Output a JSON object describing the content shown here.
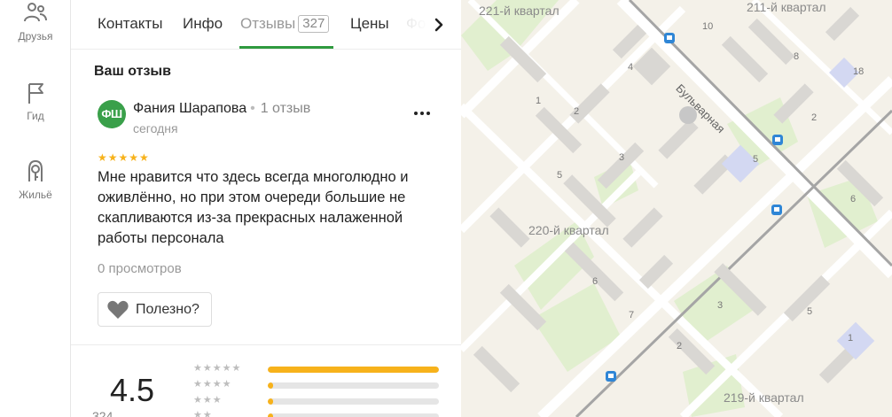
{
  "nav_rail": {
    "items": [
      {
        "label": "Друзья",
        "icon": "friends-icon"
      },
      {
        "label": "Гид",
        "icon": "flag-icon"
      },
      {
        "label": "Жильё",
        "icon": "house-key-icon"
      }
    ]
  },
  "tabs": {
    "items": [
      {
        "label": "Контакты"
      },
      {
        "label": "Инфо"
      },
      {
        "label": "Отзывы",
        "badge": "327",
        "active": true
      },
      {
        "label": "Цены"
      },
      {
        "label": "Фо"
      }
    ],
    "next_icon": "chevron-right-icon"
  },
  "review": {
    "section_title": "Ваш отзыв",
    "avatar_initials": "ФШ",
    "author": "Фания Шарапова",
    "author_review_count": "1 отзыв",
    "date": "сегодня",
    "stars": "★★★★★",
    "rating": 5,
    "text": "Мне нравится что здесь всегда многолюдно и оживлённо, но при этом очереди большие не скапливаются из-за прекрасных налаженной работы персонала",
    "views": "0 просмотров",
    "useful_label": "Полезно?"
  },
  "summary": {
    "rating_value": "4.5",
    "rating_count_partial": "324",
    "distribution": [
      {
        "stars": "★★★★★",
        "fraction": 1.0
      },
      {
        "stars": "★★★★",
        "fraction": 0.03
      },
      {
        "stars": "★★★",
        "fraction": 0.03
      },
      {
        "stars": "★★",
        "fraction": 0.03
      }
    ],
    "colors": {
      "bar_fill": "#f7b21b",
      "bar_track": "#e5e5e5"
    }
  },
  "map": {
    "labels": {
      "q221": "221-й квартал",
      "q211": "211-й квартал",
      "q220": "220-й квартал",
      "q219": "219-й квартал",
      "street": "Бульварная"
    },
    "building_numbers": {
      "n10": "10",
      "n4": "4",
      "n8": "8",
      "n18": "18",
      "n1": "1",
      "n2a": "2",
      "n2b": "2",
      "n3a": "3",
      "n5a": "5",
      "n5b": "5",
      "n6a": "6",
      "n6b": "6",
      "n7": "7",
      "n3b": "3",
      "n5c": "5",
      "n2c": "2",
      "n1b": "1"
    },
    "colors": {
      "road": "#ffffff",
      "railway": "#9a9a9a",
      "park": "#dcedc8",
      "building": "#d6d4d0",
      "bus_stop": "#2f86d6"
    }
  },
  "colors": {
    "accent": "#2f9a3f",
    "star": "#f7b21b"
  }
}
